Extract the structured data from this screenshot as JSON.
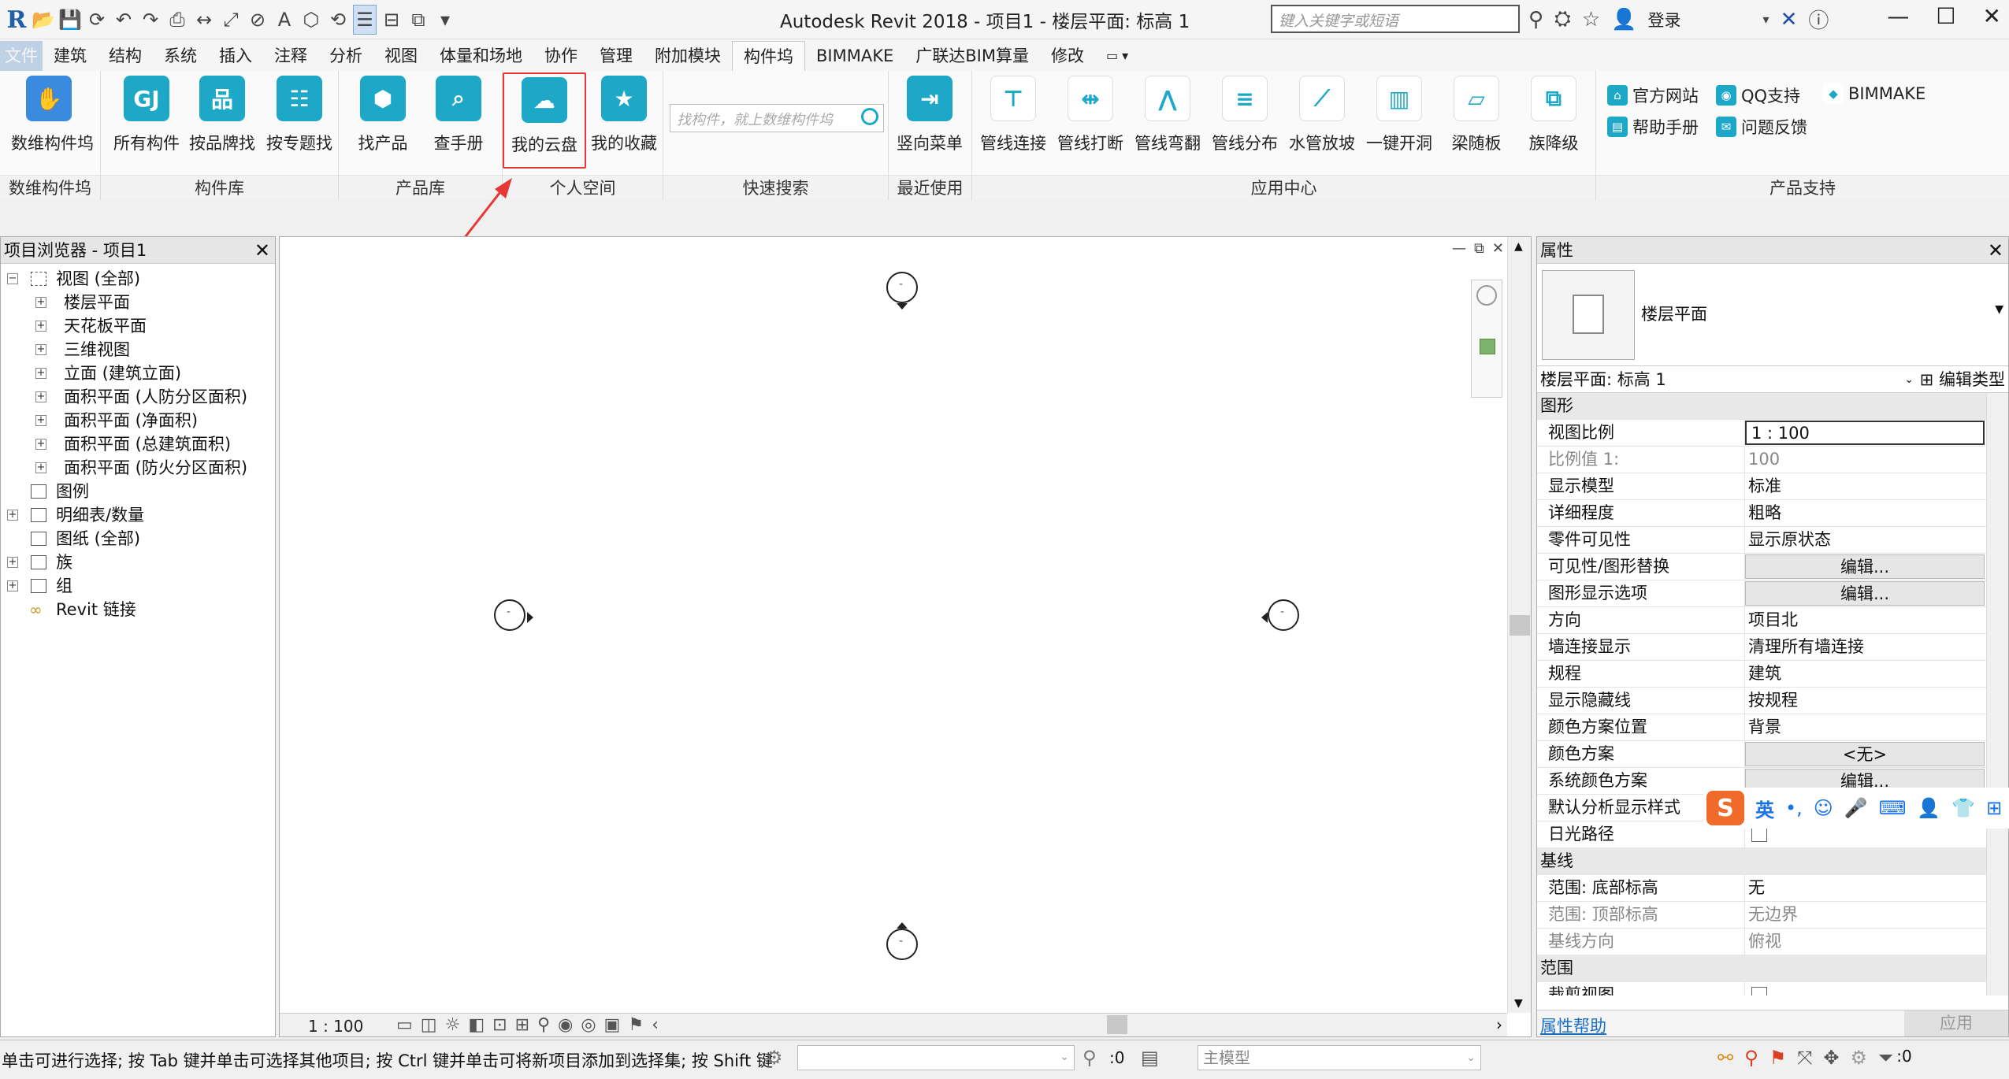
{
  "app": {
    "title": "Autodesk Revit 2018 -    项目1 - 楼层平面: 标高 1",
    "search_placeholder": "键入关键字或短语",
    "login": "登录"
  },
  "menu": {
    "tabs": [
      "文件",
      "建筑",
      "结构",
      "系统",
      "插入",
      "注释",
      "分析",
      "视图",
      "体量和场地",
      "协作",
      "管理",
      "附加模块",
      "构件坞",
      "BIMMAKE",
      "广联达BIM算量",
      "修改"
    ],
    "active": "构件坞"
  },
  "ribbon": {
    "groups": [
      {
        "label": "数维构件坞",
        "buttons": [
          "数维构件坞"
        ]
      },
      {
        "label": "构件库",
        "buttons": [
          "所有构件",
          "按品牌找",
          "按专题找"
        ]
      },
      {
        "label": "产品库",
        "buttons": [
          "找产品",
          "查手册"
        ]
      },
      {
        "label": "个人空间",
        "buttons": [
          "我的云盘",
          "我的收藏"
        ]
      },
      {
        "label": "快速搜索",
        "placeholder": "找构件，就上数维构件坞"
      },
      {
        "label": "最近使用",
        "buttons": [
          "竖向菜单"
        ]
      },
      {
        "label": "应用中心",
        "buttons": [
          "管线连接",
          "管线打断",
          "管线弯翻",
          "管线分布",
          "水管放坡",
          "一键开洞",
          "梁随板",
          "族降级"
        ]
      },
      {
        "label": "产品支持",
        "links": [
          "官方网站",
          "QQ支持",
          "BIMMAKE",
          "帮助手册",
          "问题反馈"
        ]
      }
    ],
    "highlighted": "我的云盘"
  },
  "project_browser": {
    "title": "项目浏览器 - 项目1",
    "items": [
      {
        "text": "视图 (全部)"
      },
      {
        "text": "楼层平面"
      },
      {
        "text": "天花板平面"
      },
      {
        "text": "三维视图"
      },
      {
        "text": "立面 (建筑立面)"
      },
      {
        "text": "面积平面 (人防分区面积)"
      },
      {
        "text": "面积平面 (净面积)"
      },
      {
        "text": "面积平面 (总建筑面积)"
      },
      {
        "text": "面积平面 (防火分区面积)"
      },
      {
        "text": "图例"
      },
      {
        "text": "明细表/数量"
      },
      {
        "text": "图纸 (全部)"
      },
      {
        "text": "族"
      },
      {
        "text": "组"
      },
      {
        "text": "Revit 链接"
      }
    ]
  },
  "view": {
    "scale": "1 : 100"
  },
  "properties": {
    "title": "属性",
    "type_name": "楼层平面",
    "instance_select": "楼层平面: 标高 1",
    "edit_type": "编辑类型",
    "sections": [
      {
        "name": "图形",
        "rows": [
          {
            "k": "视图比例",
            "v": "1 : 100"
          },
          {
            "k": "比例值 1:",
            "v": "100"
          },
          {
            "k": "显示模型",
            "v": "标准"
          },
          {
            "k": "详细程度",
            "v": "粗略"
          },
          {
            "k": "零件可见性",
            "v": "显示原状态"
          },
          {
            "k": "可见性/图形替换",
            "v": "编辑..."
          },
          {
            "k": "图形显示选项",
            "v": "编辑..."
          },
          {
            "k": "方向",
            "v": "项目北"
          },
          {
            "k": "墙连接显示",
            "v": "清理所有墙连接"
          },
          {
            "k": "规程",
            "v": "建筑"
          },
          {
            "k": "显示隐藏线",
            "v": "按规程"
          },
          {
            "k": "颜色方案位置",
            "v": "背景"
          },
          {
            "k": "颜色方案",
            "v": "<无>"
          },
          {
            "k": "系统颜色方案",
            "v": "编辑..."
          },
          {
            "k": "默认分析显示样式",
            "v": ""
          },
          {
            "k": "日光路径",
            "v": ""
          }
        ]
      },
      {
        "name": "基线",
        "rows": [
          {
            "k": "范围: 底部标高",
            "v": "无"
          },
          {
            "k": "范围: 顶部标高",
            "v": "无边界"
          },
          {
            "k": "基线方向",
            "v": "俯视"
          }
        ]
      },
      {
        "name": "范围",
        "rows": [
          {
            "k": "裁剪视图",
            "v": ""
          }
        ]
      }
    ],
    "help_link": "属性帮助",
    "apply": "应用"
  },
  "ime": {
    "lang": "英"
  },
  "status": {
    "message": "单击可进行选择; 按 Tab 键并单击可选择其他项目; 按 Ctrl 键并单击可将新项目添加到选择集; 按 Shift 键",
    "count": ":0",
    "model": "主模型",
    "filter_count": ":0"
  },
  "colors": {
    "accent": "#1f6bb7",
    "highlight": "#e53935",
    "ribbon_icon": "#1ea8c8"
  }
}
